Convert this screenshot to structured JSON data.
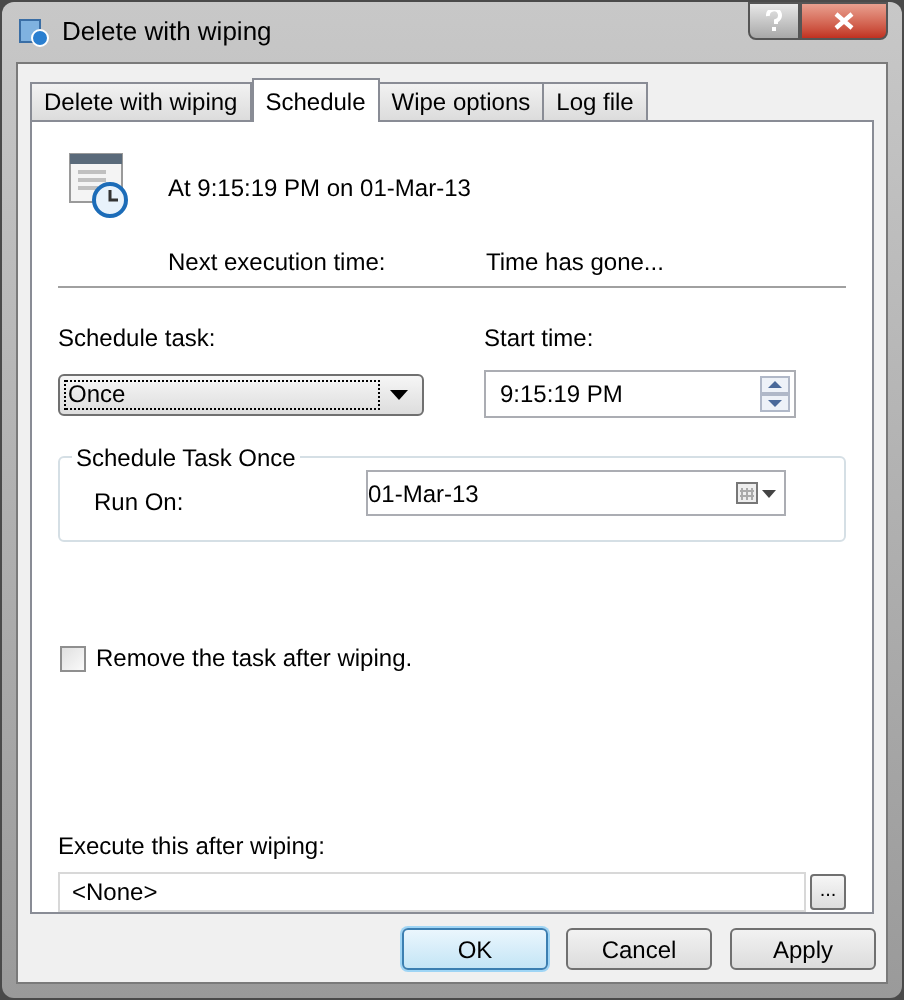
{
  "window": {
    "title": "Delete with wiping"
  },
  "tabs": [
    {
      "label": "Delete with wiping",
      "selected": false
    },
    {
      "label": "Schedule",
      "selected": true
    },
    {
      "label": "Wipe options",
      "selected": false
    },
    {
      "label": "Log file",
      "selected": false
    }
  ],
  "schedule": {
    "summary": "At 9:15:19 PM on 01-Mar-13",
    "next_label": "Next execution time:",
    "next_value": "Time has gone...",
    "task_label": "Schedule task:",
    "task_value": "Once",
    "start_label": "Start time:",
    "start_value": "9:15:19 PM",
    "group_title": "Schedule Task Once",
    "run_on_label": "Run On:",
    "run_on_value": "01-Mar-13",
    "remove_task": {
      "label": "Remove the task after wiping.",
      "checked": false
    },
    "execute_label": "Execute this after wiping:",
    "execute_value": "<None>",
    "browse": "..."
  },
  "buttons": [
    {
      "label": "OK",
      "default": true
    },
    {
      "label": "Cancel",
      "default": false
    },
    {
      "label": "Apply",
      "default": false
    }
  ]
}
